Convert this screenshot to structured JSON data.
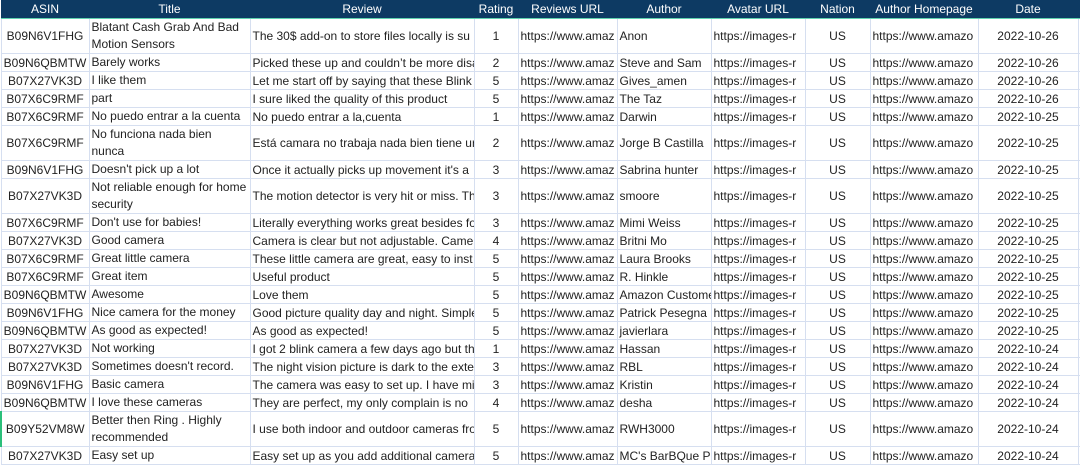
{
  "columns": [
    "ASIN",
    "Title",
    "Review",
    "Rating",
    "Reviews URL",
    "Author",
    "Avatar URL",
    "Nation",
    "Author Homepage",
    "Date"
  ],
  "rows": [
    {
      "asin": "B09N6V1FHG",
      "title": "Blatant Cash Grab And Bad Motion Sensors",
      "review": "The 30$ add-on to store files locally is su",
      "rating": "1",
      "reviews_url": "https://www.amaz",
      "author": "Anon",
      "avatar_url": "https://images-r",
      "nation": "US",
      "homepage": "https://www.amazo",
      "date": "2022-10-26",
      "tall": true
    },
    {
      "asin": "B09N6QBMTW",
      "title": "Barely works",
      "review": "Picked these up and couldn’t be more disa",
      "rating": "2",
      "reviews_url": "https://www.amaz",
      "author": "Steve and Sam",
      "avatar_url": "https://images-r",
      "nation": "US",
      "homepage": "https://www.amazo",
      "date": "2022-10-26"
    },
    {
      "asin": "B07X27VK3D",
      "title": "I like them",
      "review": "Let me start off by saying that these Blink",
      "rating": "5",
      "reviews_url": "https://www.amaz",
      "author": "Gives_amen",
      "avatar_url": "https://images-r",
      "nation": "US",
      "homepage": "https://www.amazo",
      "date": "2022-10-26"
    },
    {
      "asin": "B07X6C9RMF",
      "title": "part",
      "review": "I sure liked the quality of this product",
      "rating": "5",
      "reviews_url": "https://www.amaz",
      "author": "The Taz",
      "avatar_url": "https://images-r",
      "nation": "US",
      "homepage": "https://www.amazo",
      "date": "2022-10-26"
    },
    {
      "asin": "B07X6C9RMF",
      "title": "No puedo entrar a la cuenta",
      "review": "No puedo entrar a la,cuenta",
      "rating": "1",
      "reviews_url": "https://www.amaz",
      "author": "Darwin",
      "avatar_url": "https://images-r",
      "nation": "US",
      "homepage": "https://www.amazo",
      "date": "2022-10-25"
    },
    {
      "asin": "B07X6C9RMF",
      "title": "No funciona nada bien nunca",
      "review": "Está camara no trabaja nada bien tiene ur",
      "rating": "2",
      "reviews_url": "https://www.amaz",
      "author": "Jorge B Castilla",
      "avatar_url": "https://images-r",
      "nation": "US",
      "homepage": "https://www.amazo",
      "date": "2022-10-25",
      "tall": true
    },
    {
      "asin": "B09N6V1FHG",
      "title": "Doesn't pick up a lot",
      "review": "Once it actually picks up movement it's a",
      "rating": "3",
      "reviews_url": "https://www.amaz",
      "author": "Sabrina hunter",
      "avatar_url": "https://images-r",
      "nation": "US",
      "homepage": "https://www.amazo",
      "date": "2022-10-25"
    },
    {
      "asin": "B07X27VK3D",
      "title": "Not reliable enough for home security",
      "review": "The motion detector is very hit or miss. Th",
      "rating": "3",
      "reviews_url": "https://www.amaz",
      "author": "smoore",
      "avatar_url": "https://images-r",
      "nation": "US",
      "homepage": "https://www.amazo",
      "date": "2022-10-25",
      "tall": true
    },
    {
      "asin": "B07X6C9RMF",
      "title": "Don't use for babies!",
      "review": "Literally everything works great besides fo",
      "rating": "3",
      "reviews_url": "https://www.amaz",
      "author": "Mimi Weiss",
      "avatar_url": "https://images-r",
      "nation": "US",
      "homepage": "https://www.amazo",
      "date": "2022-10-25"
    },
    {
      "asin": "B07X27VK3D",
      "title": "Good camera",
      "review": "Camera is clear but not adjustable. Came",
      "rating": "4",
      "reviews_url": "https://www.amaz",
      "author": "Britni Mo",
      "avatar_url": "https://images-r",
      "nation": "US",
      "homepage": "https://www.amazo",
      "date": "2022-10-25"
    },
    {
      "asin": "B07X6C9RMF",
      "title": "Great little camera",
      "review": "These little camera are great, easy to inst",
      "rating": "5",
      "reviews_url": "https://www.amaz",
      "author": "Laura Brooks",
      "avatar_url": "https://images-r",
      "nation": "US",
      "homepage": "https://www.amazo",
      "date": "2022-10-25"
    },
    {
      "asin": "B07X6C9RMF",
      "title": "Great item",
      "review": "Useful product",
      "rating": "5",
      "reviews_url": "https://www.amaz",
      "author": "R. Hinkle",
      "avatar_url": "https://images-r",
      "nation": "US",
      "homepage": "https://www.amazo",
      "date": "2022-10-25"
    },
    {
      "asin": "B09N6QBMTW",
      "title": "Awesome",
      "review": "Love them",
      "rating": "5",
      "reviews_url": "https://www.amaz",
      "author": "Amazon Custome",
      "avatar_url": "https://images-r",
      "nation": "US",
      "homepage": "https://www.amazo",
      "date": "2022-10-25"
    },
    {
      "asin": "B09N6V1FHG",
      "title": "Nice camera for the money",
      "review": "Good picture quality day and night. Simple",
      "rating": "5",
      "reviews_url": "https://www.amaz",
      "author": "Patrick Pesegna",
      "avatar_url": "https://images-r",
      "nation": "US",
      "homepage": "https://www.amazo",
      "date": "2022-10-25"
    },
    {
      "asin": "B09N6QBMTW",
      "title": "As good as expected!",
      "review": "As good as expected!",
      "rating": "5",
      "reviews_url": "https://www.amaz",
      "author": "javierlara",
      "avatar_url": "https://images-r",
      "nation": "US",
      "homepage": "https://www.amazo",
      "date": "2022-10-25"
    },
    {
      "asin": "B07X27VK3D",
      "title": "Not working",
      "review": "I got 2 blink camera a few days ago but th",
      "rating": "1",
      "reviews_url": "https://www.amaz",
      "author": "Hassan",
      "avatar_url": "https://images-r",
      "nation": "US",
      "homepage": "https://www.amazo",
      "date": "2022-10-24"
    },
    {
      "asin": "B07X27VK3D",
      "title": "Sometimes doesn't record.",
      "review": "The night vision picture is dark to the exte",
      "rating": "3",
      "reviews_url": "https://www.amaz",
      "author": "RBL",
      "avatar_url": "https://images-r",
      "nation": "US",
      "homepage": "https://www.amazo",
      "date": "2022-10-24"
    },
    {
      "asin": "B09N6V1FHG",
      "title": "Basic camera",
      "review": "The camera was easy to set up. I have mi",
      "rating": "3",
      "reviews_url": "https://www.amaz",
      "author": "Kristin",
      "avatar_url": "https://images-r",
      "nation": "US",
      "homepage": "https://www.amazo",
      "date": "2022-10-24"
    },
    {
      "asin": "B09N6QBMTW",
      "title": "I love these cameras",
      "review": "They are perfect,  my only complain is no",
      "rating": "4",
      "reviews_url": "https://www.amaz",
      "author": "desha",
      "avatar_url": "https://images-r",
      "nation": "US",
      "homepage": "https://www.amazo",
      "date": "2022-10-24"
    },
    {
      "asin": "B09Y52VM8W",
      "title": "Better then Ring . Highly recommended",
      "review": "I use both indoor and outdoor cameras fro",
      "rating": "5",
      "reviews_url": "https://www.amaz",
      "author": "RWH3000",
      "avatar_url": "https://images-r",
      "nation": "US",
      "homepage": "https://www.amazo",
      "date": "2022-10-24",
      "tall": true,
      "selected": true
    },
    {
      "asin": "B07X27VK3D",
      "title": "Easy set up",
      "review": "Easy set up as you add additional camera",
      "rating": "5",
      "reviews_url": "https://www.amaz",
      "author": "MC's BarBQue Pi",
      "avatar_url": "https://images-r",
      "nation": "US",
      "homepage": "https://www.amazo",
      "date": "2022-10-24"
    }
  ]
}
